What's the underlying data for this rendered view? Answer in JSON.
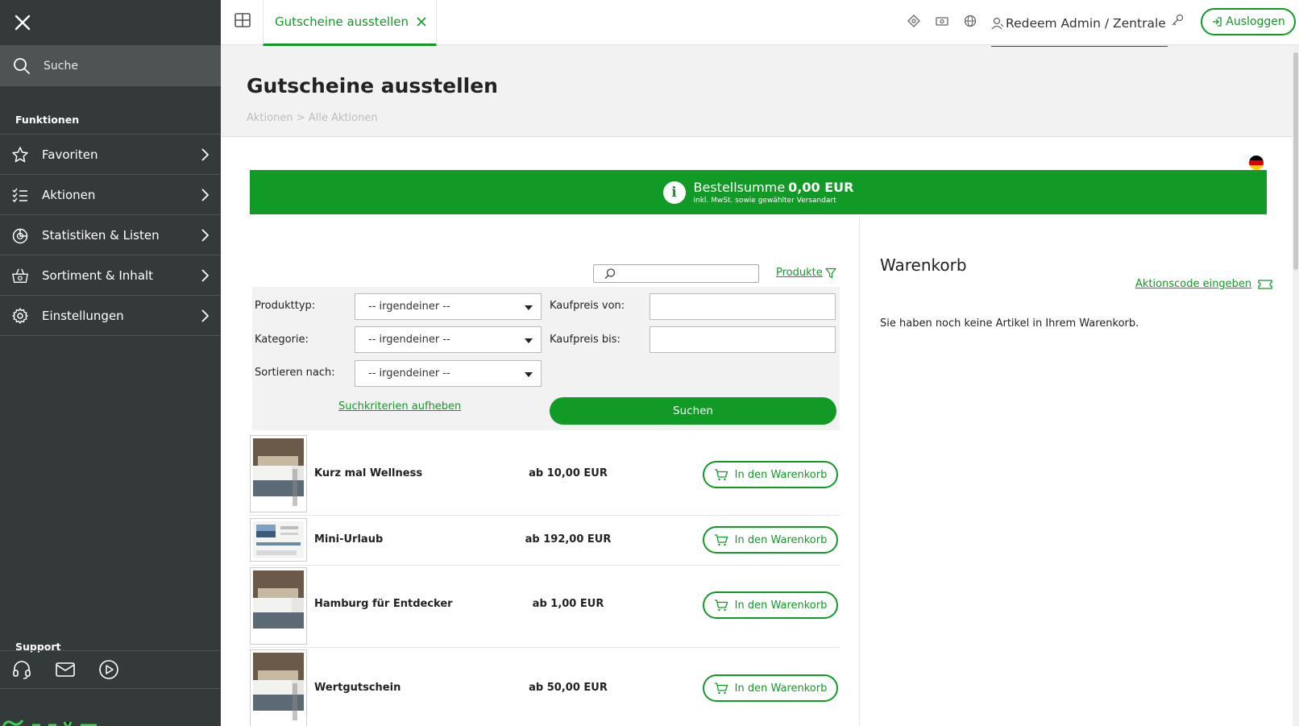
{
  "sidebar": {
    "search_placeholder": "Suche",
    "section_functions": "Funktionen",
    "items": [
      {
        "label": "Favoriten",
        "icon": "star-icon"
      },
      {
        "label": "Aktionen",
        "icon": "list-check-icon"
      },
      {
        "label": "Statistiken & Listen",
        "icon": "pie-chart-icon"
      },
      {
        "label": "Sortiment & Inhalt",
        "icon": "basket-icon"
      },
      {
        "label": "Einstellungen",
        "icon": "gear-icon"
      }
    ],
    "section_support": "Support",
    "support_icons": [
      "headset-icon",
      "mail-icon",
      "play-icon"
    ]
  },
  "topbar": {
    "tab_label": "Gutscheine ausstellen",
    "user_label": "Redeem Admin / Zentrale",
    "logout_label": "Ausloggen"
  },
  "page": {
    "title": "Gutscheine ausstellen",
    "breadcrumb": [
      "Aktionen",
      "Alle Aktionen"
    ],
    "breadcrumb_sep": ">"
  },
  "banner": {
    "label": "Bestellsumme",
    "amount": "0,00 EUR",
    "subtext": "inkl. MwSt. sowie gewählter Versandart"
  },
  "filter": {
    "search_placeholder": "",
    "products_link": "Produkte",
    "produkttyp_label": "Produkttyp:",
    "produkttyp_value": "-- irgendeiner --",
    "kategorie_label": "Kategorie:",
    "kategorie_value": "-- irgendeiner --",
    "sortieren_label": "Sortieren nach:",
    "sortieren_value": "-- irgendeiner --",
    "kaufpreis_von_label": "Kaufpreis von:",
    "kaufpreis_von_value": "",
    "kaufpreis_bis_label": "Kaufpreis bis:",
    "kaufpreis_bis_value": "",
    "reset_label": "Suchkriterien aufheben",
    "search_button": "Suchen"
  },
  "products": [
    {
      "name": "Kurz mal Wellness",
      "price": "ab 10,00 EUR",
      "button": "In den Warenkorb"
    },
    {
      "name": "Mini-Urlaub",
      "price": "ab 192,00 EUR",
      "button": "In den Warenkorb"
    },
    {
      "name": "Hamburg für Entdecker",
      "price": "ab 1,00 EUR",
      "button": "In den Warenkorb"
    },
    {
      "name": "Wertgutschein",
      "price": "ab 50,00 EUR",
      "button": "In den Warenkorb"
    }
  ],
  "cart": {
    "title": "Warenkorb",
    "promo_link": "Aktionscode eingeben",
    "empty_text": "Sie haben noch keine Artikel in Ihrem Warenkorb."
  },
  "colors": {
    "accent": "#129a26",
    "sidebar_bg": "#343a3a"
  }
}
